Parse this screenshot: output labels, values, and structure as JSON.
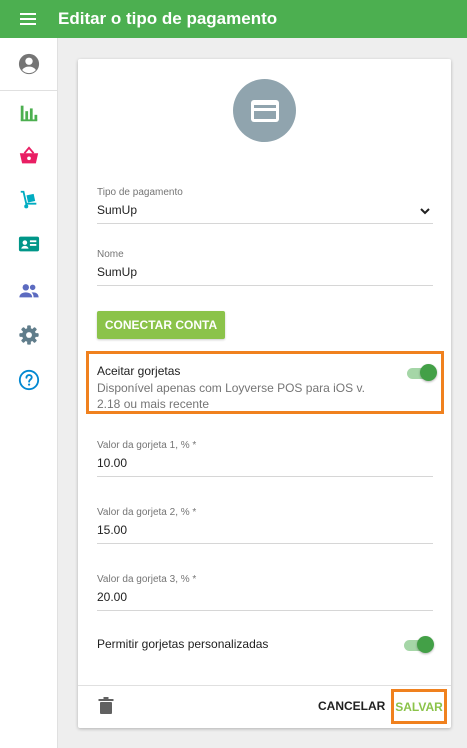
{
  "header": {
    "title": "Editar o tipo de pagamento",
    "menu_icon": "menu-icon",
    "background": "#4caf50"
  },
  "sidebar": {
    "items": [
      {
        "name": "account",
        "icon": "account-circle-icon",
        "color": "#757575"
      },
      {
        "name": "reports",
        "icon": "bar-chart-icon",
        "color": "#4caf50"
      },
      {
        "name": "items",
        "icon": "basket-icon",
        "color": "#e91e63"
      },
      {
        "name": "inventory",
        "icon": "dolly-icon",
        "color": "#00acc1"
      },
      {
        "name": "employees",
        "icon": "id-card-icon",
        "color": "#009688"
      },
      {
        "name": "customers",
        "icon": "people-icon",
        "color": "#5c6bc0"
      },
      {
        "name": "settings",
        "icon": "gear-icon",
        "color": "#607d8b"
      },
      {
        "name": "help",
        "icon": "help-icon",
        "color": "#0288d1"
      }
    ]
  },
  "form": {
    "hero_icon": "credit-card-icon",
    "payment_type": {
      "label": "Tipo de pagamento",
      "value": "SumUp"
    },
    "name": {
      "label": "Nome",
      "value": "SumUp"
    },
    "connect_button": "CONECTAR CONTA",
    "accept_tips": {
      "title": "Aceitar gorjetas",
      "description": "Disponível apenas com Loyverse POS para iOS v. 2.18 ou mais recente",
      "enabled": true
    },
    "tips": [
      {
        "label": "Valor da gorjeta 1, % *",
        "value": "10.00"
      },
      {
        "label": "Valor da gorjeta 2, % *",
        "value": "15.00"
      },
      {
        "label": "Valor da gorjeta 3, % *",
        "value": "20.00"
      }
    ],
    "custom_tips": {
      "label": "Permitir gorjetas personalizadas",
      "enabled": true
    }
  },
  "footer": {
    "cancel": "CANCELAR",
    "save": "SALVAR"
  },
  "colors": {
    "accent": "#4caf50",
    "highlight": "#f0811e",
    "save": "#8bc34a"
  }
}
